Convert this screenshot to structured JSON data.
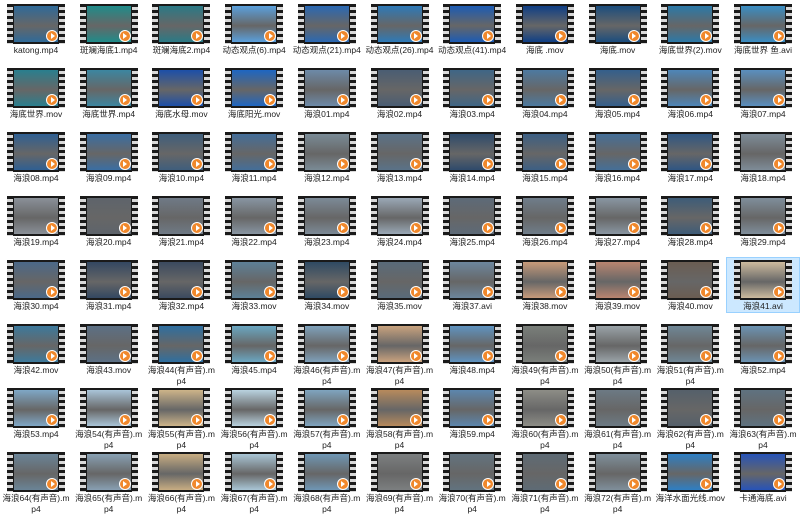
{
  "files": [
    {
      "name": "katong.mp4",
      "bg": "#2f6a99"
    },
    {
      "name": "斑斓海底1.mp4",
      "bg": "#1f8c8a"
    },
    {
      "name": "斑斓海底2.mp4",
      "bg": "#2a7a86"
    },
    {
      "name": "动态观点(6).mp4",
      "bg": "#5aa0dd"
    },
    {
      "name": "动态观点(21).mp4",
      "bg": "#2a68b3"
    },
    {
      "name": "动态观点(26).mp4",
      "bg": "#2d7ab8"
    },
    {
      "name": "动态观点(41).mp4",
      "bg": "#1c5bb4"
    },
    {
      "name": "海底 .mov",
      "bg": "#0f3f86"
    },
    {
      "name": "海底.mov",
      "bg": "#1b4d7e"
    },
    {
      "name": "海底世界(2).mov",
      "bg": "#2b79a8"
    },
    {
      "name": "海底世界 鱼.avi",
      "bg": "#3a8ec4"
    },
    {
      "name": "海底世界.mov",
      "bg": "#2a7f8e"
    },
    {
      "name": "海底世界.mp4",
      "bg": "#3c86a0"
    },
    {
      "name": "海底水母.mov",
      "bg": "#1d4fa8"
    },
    {
      "name": "海底阳光.mov",
      "bg": "#1e66c2"
    },
    {
      "name": "海浪01.mp4",
      "bg": "#6d8aa8"
    },
    {
      "name": "海浪02.mp4",
      "bg": "#4a5d73"
    },
    {
      "name": "海浪03.mp4",
      "bg": "#3f6686"
    },
    {
      "name": "海浪04.mp4",
      "bg": "#4d7aa0"
    },
    {
      "name": "海浪05.mp4",
      "bg": "#345f8c"
    },
    {
      "name": "海浪06.mp4",
      "bg": "#4e86b8"
    },
    {
      "name": "海浪07.mp4",
      "bg": "#5a8fbf"
    },
    {
      "name": "海浪08.mp4",
      "bg": "#2f5f92"
    },
    {
      "name": "海浪09.mp4",
      "bg": "#3a6ea3"
    },
    {
      "name": "海浪10.mp4",
      "bg": "#3f5e7c"
    },
    {
      "name": "海浪11.mp4",
      "bg": "#446e99"
    },
    {
      "name": "海浪12.mp4",
      "bg": "#7a8b96"
    },
    {
      "name": "海浪13.mp4",
      "bg": "#5a7288"
    },
    {
      "name": "海浪14.mp4",
      "bg": "#2e4a6b"
    },
    {
      "name": "海浪15.mp4",
      "bg": "#3c5f84"
    },
    {
      "name": "海浪16.mp4",
      "bg": "#456f98"
    },
    {
      "name": "海浪17.mp4",
      "bg": "#2f5683"
    },
    {
      "name": "海浪18.mp4",
      "bg": "#7e8c98"
    },
    {
      "name": "海浪19.mp4",
      "bg": "#8a9098"
    },
    {
      "name": "海浪20.mp4",
      "bg": "#5e646b"
    },
    {
      "name": "海浪21.mp4",
      "bg": "#6f7a86"
    },
    {
      "name": "海浪22.mp4",
      "bg": "#8895a2"
    },
    {
      "name": "海浪23.mp4",
      "bg": "#7c8a97"
    },
    {
      "name": "海浪24.mp4",
      "bg": "#9aa8b6"
    },
    {
      "name": "海浪25.mp4",
      "bg": "#5d6a78"
    },
    {
      "name": "海浪26.mp4",
      "bg": "#6f7d8a"
    },
    {
      "name": "海浪27.mp4",
      "bg": "#8996a2"
    },
    {
      "name": "海浪28.mp4",
      "bg": "#3e5c78"
    },
    {
      "name": "海浪29.mp4",
      "bg": "#7f8e9b"
    },
    {
      "name": "海浪30.mp4",
      "bg": "#4b6888"
    },
    {
      "name": "海浪31.mp4",
      "bg": "#334761"
    },
    {
      "name": "海浪32.mp4",
      "bg": "#3b4a5f"
    },
    {
      "name": "海浪33.mov",
      "bg": "#5d8097"
    },
    {
      "name": "海浪34.mov",
      "bg": "#2f4a63"
    },
    {
      "name": "海浪35.mov",
      "bg": "#596b7a"
    },
    {
      "name": "海浪37.avi",
      "bg": "#6c869d"
    },
    {
      "name": "海浪38.mov",
      "bg": "#c79a7a"
    },
    {
      "name": "海浪39.mov",
      "bg": "#b98570"
    },
    {
      "name": "海浪40.mov",
      "bg": "#6b5d52"
    },
    {
      "name": "海浪41.avi",
      "bg": "#cdbb9e"
    },
    {
      "name": "海浪42.mov",
      "bg": "#3d7a9c"
    },
    {
      "name": "海浪43.mov",
      "bg": "#5c7085"
    },
    {
      "name": "海浪44(有声音).mp4",
      "bg": "#2e6fa0"
    },
    {
      "name": "海浪45.mp4",
      "bg": "#6aa7c2"
    },
    {
      "name": "海浪46(有声音).mp4",
      "bg": "#7fa1bb"
    },
    {
      "name": "海浪47(有声音).mp4",
      "bg": "#c9a27e"
    },
    {
      "name": "海浪48.mp4",
      "bg": "#5f93c0"
    },
    {
      "name": "海浪49(有声音).mp4",
      "bg": "#7a7f7a"
    },
    {
      "name": "海浪50(有声音).mp4",
      "bg": "#9aa3a8"
    },
    {
      "name": "海浪51(有声音).mp4",
      "bg": "#6f8796"
    },
    {
      "name": "海浪52.mp4",
      "bg": "#6b93b3"
    },
    {
      "name": "海浪53.mp4",
      "bg": "#7fa7c6"
    },
    {
      "name": "海浪54(有声音).mp4",
      "bg": "#a9c4d8"
    },
    {
      "name": "海浪55(有声音).mp4",
      "bg": "#cdb489"
    },
    {
      "name": "海浪56(有声音).mp4",
      "bg": "#b9d2df"
    },
    {
      "name": "海浪57(有声音).mp4",
      "bg": "#7fa4bf"
    },
    {
      "name": "海浪58(有声音).mp4",
      "bg": "#b78a5c"
    },
    {
      "name": "海浪59.mp4",
      "bg": "#5c86ad"
    },
    {
      "name": "海浪60(有声音).mp4",
      "bg": "#8d8d86"
    },
    {
      "name": "海浪61(有声音).mp4",
      "bg": "#6c7a84"
    },
    {
      "name": "海浪62(有声音).mp4",
      "bg": "#55606a"
    },
    {
      "name": "海浪63(有声音).mp4",
      "bg": "#5f7280"
    },
    {
      "name": "海浪64(有声音).mp4",
      "bg": "#6a8497"
    },
    {
      "name": "海浪65(有声音).mp4",
      "bg": "#88a0b3"
    },
    {
      "name": "海浪66(有声音).mp4",
      "bg": "#c8ad82"
    },
    {
      "name": "海浪67(有声音).mp4",
      "bg": "#a9c6d6"
    },
    {
      "name": "海浪68(有声音).mp4",
      "bg": "#6f97b5"
    },
    {
      "name": "海浪69(有声音).mp4",
      "bg": "#7c7f80"
    },
    {
      "name": "海浪70(有声音).mp4",
      "bg": "#62737f"
    },
    {
      "name": "海浪71(有声音).mp4",
      "bg": "#5e6b75"
    },
    {
      "name": "海浪72(有声音).mp4",
      "bg": "#7f8f9b"
    },
    {
      "name": "海洋水面光线.mov",
      "bg": "#2e7fc4"
    },
    {
      "name": "卡通海底.avi",
      "bg": "#2753b8"
    }
  ],
  "selected_index": 54
}
